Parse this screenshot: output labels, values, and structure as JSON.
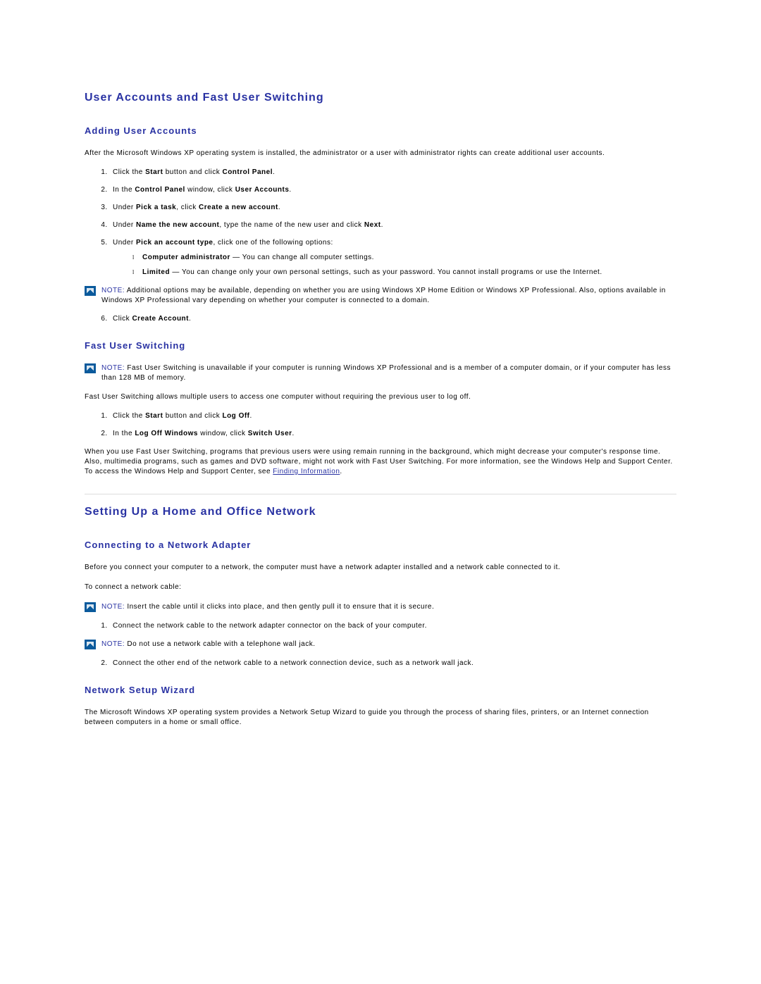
{
  "sec1": {
    "heading": "User Accounts and Fast User Switching",
    "sub_adding": {
      "heading": "Adding User Accounts",
      "intro": "After the Microsoft Windows XP operating system is installed, the administrator or a user with administrator rights can create additional user accounts.",
      "steps123456": {
        "s1a": "Click the ",
        "s1b": "Start",
        "s1c": " button and click ",
        "s1d": "Control Panel",
        "s1e": ".",
        "s2a": "In the ",
        "s2b": "Control Panel",
        "s2c": " window, click ",
        "s2d": "User Accounts",
        "s2e": ".",
        "s3a": "Under ",
        "s3b": "Pick a task",
        "s3c": ", click ",
        "s3d": "Create a new account",
        "s3e": ".",
        "s4a": "Under ",
        "s4b": "Name the new account",
        "s4c": ", type the name of the new user and click ",
        "s4d": "Next",
        "s4e": ".",
        "s5a": "Under ",
        "s5b": "Pick an account type",
        "s5c": ", click one of the following options:",
        "s5_opt1a": "Computer administrator",
        "s5_opt1b": " — You can change all computer settings.",
        "s5_opt2a": "Limited",
        "s5_opt2b": " — You can change only your own personal settings, such as your password. You cannot install programs or use the Internet.",
        "s6a": "Click ",
        "s6b": "Create Account",
        "s6c": "."
      },
      "note1_label": "NOTE:",
      "note1_text": " Additional options may be available, depending on whether you are using Windows XP Home Edition or Windows XP Professional. Also, options available in Windows XP Professional vary depending on whether your computer is connected to a domain."
    },
    "sub_fast": {
      "heading": "Fast User Switching",
      "note_label": "NOTE:",
      "note_text": " Fast User Switching is unavailable if your computer is running Windows XP Professional and is a member of a computer domain, or if your computer has less than 128 MB of memory.",
      "p1": "Fast User Switching allows multiple users to access one computer without requiring the previous user to log off.",
      "s1a": "Click the ",
      "s1b": "Start",
      "s1c": " button and click ",
      "s1d": "Log Off",
      "s1e": ".",
      "s2a": "In the ",
      "s2b": "Log Off Windows",
      "s2c": " window, click ",
      "s2d": "Switch User",
      "s2e": ".",
      "p2a": "When you use Fast User Switching, programs that previous users were using remain running in the background, which might decrease your computer's response time. Also, multimedia programs, such as games and DVD software, might not work with Fast User Switching. For more information, see the Windows Help and Support Center. To access the Windows Help and Support Center, see ",
      "p2_link": "Finding Information",
      "p2b": "."
    }
  },
  "sec2": {
    "heading": "Setting Up a Home and Office Network",
    "sub_conn": {
      "heading": "Connecting to a Network Adapter",
      "p1": "Before you connect your computer to a network, the computer must have a network adapter installed and a network cable connected to it.",
      "p2": "To connect a network cable:",
      "note1_label": "NOTE:",
      "note1_text": " Insert the cable until it clicks into place, and then gently pull it to ensure that it is secure.",
      "s1": "Connect the network cable to the network adapter connector on the back of your computer.",
      "note2_label": "NOTE:",
      "note2_text": " Do not use a network cable with a telephone wall jack.",
      "s2": "Connect the other end of the network cable to a network connection device, such as a network wall jack."
    },
    "sub_wiz": {
      "heading": "Network Setup Wizard",
      "p1": "The Microsoft Windows XP operating system provides a Network Setup Wizard to guide you through the process of sharing files, printers, or an Internet connection between computers in a home or small office."
    }
  }
}
